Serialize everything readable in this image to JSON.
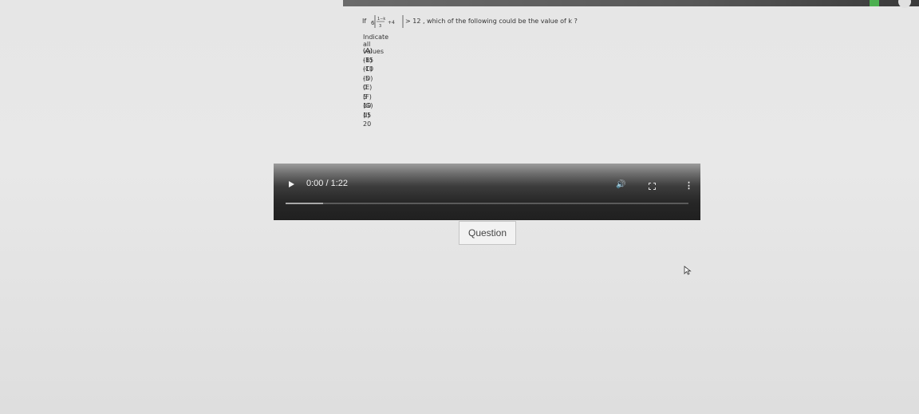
{
  "question": {
    "if_word": "If",
    "coef": "6",
    "frac_num": "1−k",
    "frac_den": "3",
    "plus": "+4",
    "rest": "> 12 , which of the following could be the value of k ?",
    "instruction": "Indicate all values",
    "options": [
      {
        "label": "(A) -15"
      },
      {
        "label": "(B) -10"
      },
      {
        "label": "(C) -5"
      },
      {
        "label": "(D) 0"
      },
      {
        "label": "(E) 5"
      },
      {
        "label": "(F) 10"
      },
      {
        "label": "(G) 15"
      },
      {
        "label": "(I) 20"
      }
    ]
  },
  "player": {
    "time": "0:00 / 1:22",
    "progress": 0,
    "icons": [
      "play-icon",
      "volume-icon",
      "fullscreen-icon",
      "more-options-icon"
    ]
  },
  "question_button": {
    "label": "Question"
  }
}
